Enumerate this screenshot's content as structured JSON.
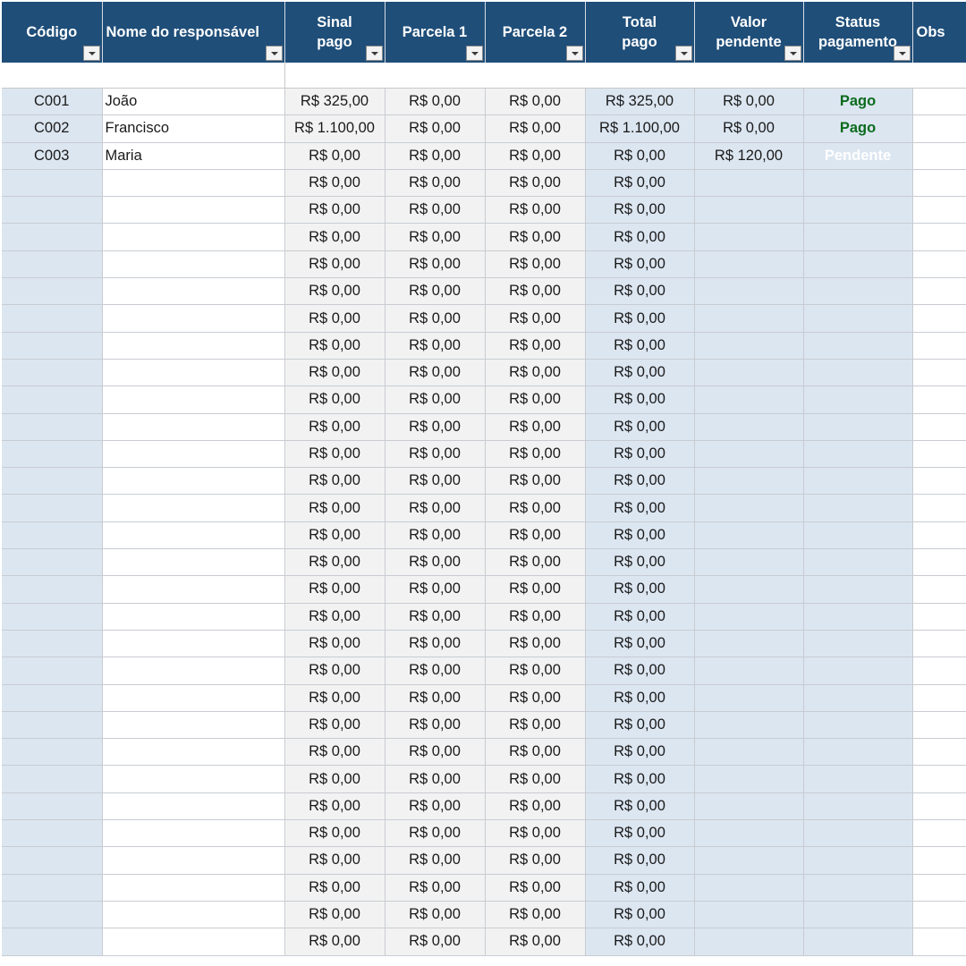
{
  "headers": [
    {
      "label": "Código",
      "align": "center"
    },
    {
      "label": "Nome do responsável",
      "align": "left"
    },
    {
      "label": "Sinal\npago",
      "align": "center"
    },
    {
      "label": "Parcela 1",
      "align": "center"
    },
    {
      "label": "Parcela 2",
      "align": "center"
    },
    {
      "label": "Total\npago",
      "align": "center"
    },
    {
      "label": "Valor\npendente",
      "align": "center"
    },
    {
      "label": "Status\npagamento",
      "align": "center"
    },
    {
      "label": "Obs",
      "align": "left"
    }
  ],
  "rows": [
    {
      "code": "C001",
      "name": "João",
      "sinal": "R$ 325,00",
      "p1": "R$ 0,00",
      "p2": "R$ 0,00",
      "total": "R$ 325,00",
      "pendente": "R$ 0,00",
      "status": "Pago"
    },
    {
      "code": "C002",
      "name": "Francisco",
      "sinal": "R$ 1.100,00",
      "p1": "R$ 0,00",
      "p2": "R$ 0,00",
      "total": "R$ 1.100,00",
      "pendente": "R$ 0,00",
      "status": "Pago"
    },
    {
      "code": "C003",
      "name": "Maria",
      "sinal": "R$ 0,00",
      "p1": "R$ 0,00",
      "p2": "R$ 0,00",
      "total": "R$ 0,00",
      "pendente": "R$ 120,00",
      "status": "Pendente"
    },
    {
      "code": "",
      "name": "",
      "sinal": "R$ 0,00",
      "p1": "R$ 0,00",
      "p2": "R$ 0,00",
      "total": "R$ 0,00",
      "pendente": "",
      "status": ""
    },
    {
      "code": "",
      "name": "",
      "sinal": "R$ 0,00",
      "p1": "R$ 0,00",
      "p2": "R$ 0,00",
      "total": "R$ 0,00",
      "pendente": "",
      "status": ""
    },
    {
      "code": "",
      "name": "",
      "sinal": "R$ 0,00",
      "p1": "R$ 0,00",
      "p2": "R$ 0,00",
      "total": "R$ 0,00",
      "pendente": "",
      "status": ""
    },
    {
      "code": "",
      "name": "",
      "sinal": "R$ 0,00",
      "p1": "R$ 0,00",
      "p2": "R$ 0,00",
      "total": "R$ 0,00",
      "pendente": "",
      "status": ""
    },
    {
      "code": "",
      "name": "",
      "sinal": "R$ 0,00",
      "p1": "R$ 0,00",
      "p2": "R$ 0,00",
      "total": "R$ 0,00",
      "pendente": "",
      "status": ""
    },
    {
      "code": "",
      "name": "",
      "sinal": "R$ 0,00",
      "p1": "R$ 0,00",
      "p2": "R$ 0,00",
      "total": "R$ 0,00",
      "pendente": "",
      "status": ""
    },
    {
      "code": "",
      "name": "",
      "sinal": "R$ 0,00",
      "p1": "R$ 0,00",
      "p2": "R$ 0,00",
      "total": "R$ 0,00",
      "pendente": "",
      "status": ""
    },
    {
      "code": "",
      "name": "",
      "sinal": "R$ 0,00",
      "p1": "R$ 0,00",
      "p2": "R$ 0,00",
      "total": "R$ 0,00",
      "pendente": "",
      "status": ""
    },
    {
      "code": "",
      "name": "",
      "sinal": "R$ 0,00",
      "p1": "R$ 0,00",
      "p2": "R$ 0,00",
      "total": "R$ 0,00",
      "pendente": "",
      "status": ""
    },
    {
      "code": "",
      "name": "",
      "sinal": "R$ 0,00",
      "p1": "R$ 0,00",
      "p2": "R$ 0,00",
      "total": "R$ 0,00",
      "pendente": "",
      "status": ""
    },
    {
      "code": "",
      "name": "",
      "sinal": "R$ 0,00",
      "p1": "R$ 0,00",
      "p2": "R$ 0,00",
      "total": "R$ 0,00",
      "pendente": "",
      "status": ""
    },
    {
      "code": "",
      "name": "",
      "sinal": "R$ 0,00",
      "p1": "R$ 0,00",
      "p2": "R$ 0,00",
      "total": "R$ 0,00",
      "pendente": "",
      "status": ""
    },
    {
      "code": "",
      "name": "",
      "sinal": "R$ 0,00",
      "p1": "R$ 0,00",
      "p2": "R$ 0,00",
      "total": "R$ 0,00",
      "pendente": "",
      "status": ""
    },
    {
      "code": "",
      "name": "",
      "sinal": "R$ 0,00",
      "p1": "R$ 0,00",
      "p2": "R$ 0,00",
      "total": "R$ 0,00",
      "pendente": "",
      "status": ""
    },
    {
      "code": "",
      "name": "",
      "sinal": "R$ 0,00",
      "p1": "R$ 0,00",
      "p2": "R$ 0,00",
      "total": "R$ 0,00",
      "pendente": "",
      "status": ""
    },
    {
      "code": "",
      "name": "",
      "sinal": "R$ 0,00",
      "p1": "R$ 0,00",
      "p2": "R$ 0,00",
      "total": "R$ 0,00",
      "pendente": "",
      "status": ""
    },
    {
      "code": "",
      "name": "",
      "sinal": "R$ 0,00",
      "p1": "R$ 0,00",
      "p2": "R$ 0,00",
      "total": "R$ 0,00",
      "pendente": "",
      "status": ""
    },
    {
      "code": "",
      "name": "",
      "sinal": "R$ 0,00",
      "p1": "R$ 0,00",
      "p2": "R$ 0,00",
      "total": "R$ 0,00",
      "pendente": "",
      "status": ""
    },
    {
      "code": "",
      "name": "",
      "sinal": "R$ 0,00",
      "p1": "R$ 0,00",
      "p2": "R$ 0,00",
      "total": "R$ 0,00",
      "pendente": "",
      "status": ""
    },
    {
      "code": "",
      "name": "",
      "sinal": "R$ 0,00",
      "p1": "R$ 0,00",
      "p2": "R$ 0,00",
      "total": "R$ 0,00",
      "pendente": "",
      "status": ""
    },
    {
      "code": "",
      "name": "",
      "sinal": "R$ 0,00",
      "p1": "R$ 0,00",
      "p2": "R$ 0,00",
      "total": "R$ 0,00",
      "pendente": "",
      "status": ""
    },
    {
      "code": "",
      "name": "",
      "sinal": "R$ 0,00",
      "p1": "R$ 0,00",
      "p2": "R$ 0,00",
      "total": "R$ 0,00",
      "pendente": "",
      "status": ""
    },
    {
      "code": "",
      "name": "",
      "sinal": "R$ 0,00",
      "p1": "R$ 0,00",
      "p2": "R$ 0,00",
      "total": "R$ 0,00",
      "pendente": "",
      "status": ""
    },
    {
      "code": "",
      "name": "",
      "sinal": "R$ 0,00",
      "p1": "R$ 0,00",
      "p2": "R$ 0,00",
      "total": "R$ 0,00",
      "pendente": "",
      "status": ""
    },
    {
      "code": "",
      "name": "",
      "sinal": "R$ 0,00",
      "p1": "R$ 0,00",
      "p2": "R$ 0,00",
      "total": "R$ 0,00",
      "pendente": "",
      "status": ""
    },
    {
      "code": "",
      "name": "",
      "sinal": "R$ 0,00",
      "p1": "R$ 0,00",
      "p2": "R$ 0,00",
      "total": "R$ 0,00",
      "pendente": "",
      "status": ""
    },
    {
      "code": "",
      "name": "",
      "sinal": "R$ 0,00",
      "p1": "R$ 0,00",
      "p2": "R$ 0,00",
      "total": "R$ 0,00",
      "pendente": "",
      "status": ""
    },
    {
      "code": "",
      "name": "",
      "sinal": "R$ 0,00",
      "p1": "R$ 0,00",
      "p2": "R$ 0,00",
      "total": "R$ 0,00",
      "pendente": "",
      "status": ""
    },
    {
      "code": "",
      "name": "",
      "sinal": "R$ 0,00",
      "p1": "R$ 0,00",
      "p2": "R$ 0,00",
      "total": "R$ 0,00",
      "pendente": "",
      "status": ""
    }
  ],
  "status_colors": {
    "Pago": "#0b6b1d",
    "Pendente": "#ffffff"
  },
  "colors": {
    "header_bg": "#1f4e79",
    "light_blue": "#dce6f1",
    "light_gray": "#f2f2f2"
  }
}
